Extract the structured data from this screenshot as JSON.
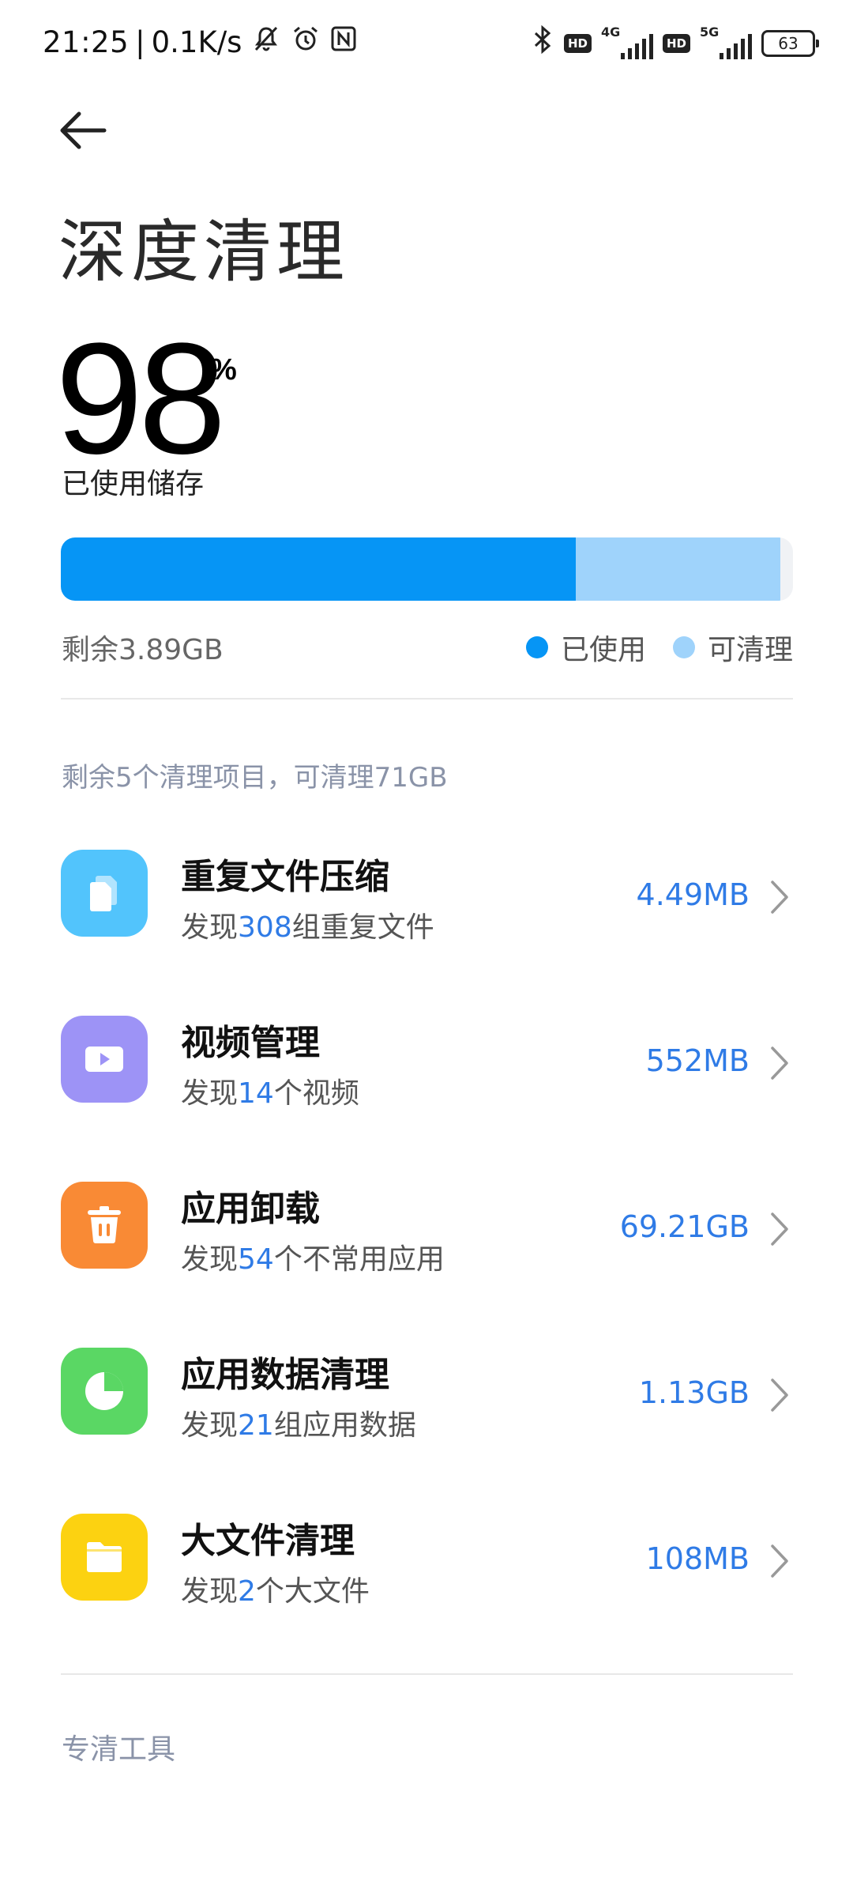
{
  "status_bar": {
    "time": "21:25",
    "separator": "|",
    "speed": "0.1K/s",
    "net1": "4G",
    "net2": "5G",
    "hd_label": "HD",
    "battery": "63",
    "icons": [
      "mute-bell-icon",
      "alarm-icon",
      "nfc-icon",
      "bluetooth-icon",
      "signal-icon",
      "battery-icon"
    ]
  },
  "header": {
    "title": "深度清理"
  },
  "storage": {
    "percent_value": "98",
    "percent_sign": "%",
    "used_label": "已使用储存",
    "remaining": "剩余3.89GB",
    "used_fraction": 0.703,
    "cleanable_fraction": 0.28,
    "legend": {
      "used": "已使用",
      "cleanable": "可清理"
    },
    "colors": {
      "used": "#0695f5",
      "cleanable": "#9fd3fb",
      "track": "#f0f2f5"
    }
  },
  "summary": "剩余5个清理项目，可清理71GB",
  "items": [
    {
      "title": "重复文件压缩",
      "desc_prefix": "发现",
      "desc_num": "308",
      "desc_suffix": "组重复文件",
      "size": "4.49MB",
      "icon": "duplicate-files-icon",
      "color": "#52c4fc"
    },
    {
      "title": "视频管理",
      "desc_prefix": "发现",
      "desc_num": "14",
      "desc_suffix": "个视频",
      "size": "552MB",
      "icon": "video-icon",
      "color": "#9d93f6"
    },
    {
      "title": "应用卸载",
      "desc_prefix": "发现",
      "desc_num": "54",
      "desc_suffix": "个不常用应用",
      "size": "69.21GB",
      "icon": "trash-icon",
      "color": "#f98a35"
    },
    {
      "title": "应用数据清理",
      "desc_prefix": "发现",
      "desc_num": "21",
      "desc_suffix": "组应用数据",
      "size": "1.13GB",
      "icon": "pie-chart-icon",
      "color": "#5ad764"
    },
    {
      "title": "大文件清理",
      "desc_prefix": "发现",
      "desc_num": "2",
      "desc_suffix": "个大文件",
      "size": "108MB",
      "icon": "folder-icon",
      "color": "#fcd211"
    }
  ],
  "tools_section": "专清工具"
}
